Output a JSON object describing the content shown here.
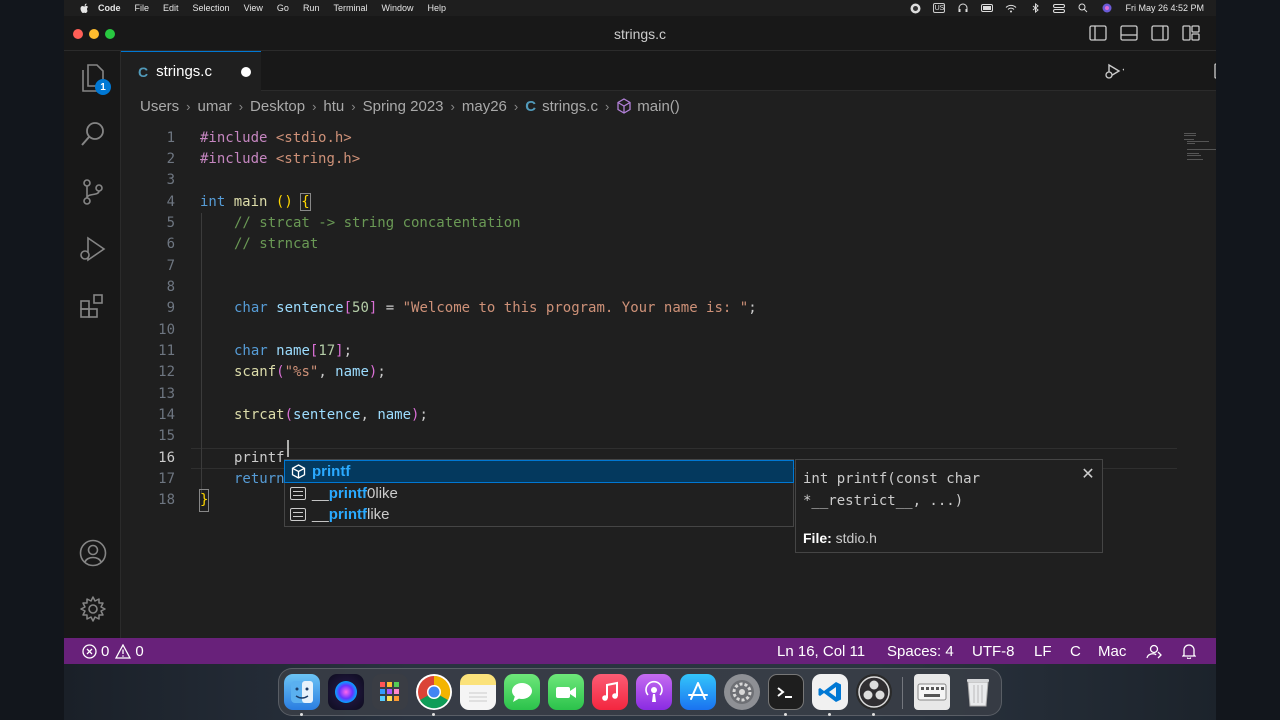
{
  "menubar": {
    "items": [
      "Code",
      "File",
      "Edit",
      "Selection",
      "View",
      "Go",
      "Run",
      "Terminal",
      "Window",
      "Help"
    ],
    "keyboard": "US",
    "clock": "Fri May 26  4:52 PM"
  },
  "window": {
    "title": "strings.c"
  },
  "activity": {
    "explorer_badge": "1"
  },
  "tab": {
    "icon": "C",
    "name": "strings.c"
  },
  "breadcrumb": {
    "parts": [
      "Users",
      "umar",
      "Desktop",
      "htu",
      "Spring 2023",
      "may26"
    ],
    "file_icon": "C",
    "file": "strings.c",
    "symbol": "main()"
  },
  "editor": {
    "line_numbers": [
      "1",
      "2",
      "3",
      "4",
      "5",
      "6",
      "7",
      "8",
      "9",
      "10",
      "11",
      "12",
      "13",
      "14",
      "15",
      "16",
      "17",
      "18"
    ],
    "active_line": "16",
    "l1_a": "#include",
    "l1_b": "<stdio.h>",
    "l2_a": "#include",
    "l2_b": "<string.h>",
    "l4_kw": "int",
    "l4_fn": "main",
    "l4_paren": "()",
    "l4_brace": "{",
    "l5": "// strcat -> string concatentation",
    "l6": "// strncat",
    "l9_kw": "char",
    "l9_var": "sentence",
    "l9_lb": "[",
    "l9_num": "50",
    "l9_rb": "]",
    "l9_eq": " = ",
    "l9_str": "\"Welcome to this program. Your name is: \"",
    "l9_end": ";",
    "l11_kw": "char",
    "l11_var": "name",
    "l11_lb": "[",
    "l11_num": "17",
    "l11_rb": "]",
    "l11_end": ";",
    "l12_fn": "scanf",
    "l12_lp": "(",
    "l12_str": "\"%s\"",
    "l12_comma": ", ",
    "l12_var": "name",
    "l12_rp": ")",
    "l12_end": ";",
    "l14_fn": "strcat",
    "l14_lp": "(",
    "l14_v1": "sentence",
    "l14_comma": ", ",
    "l14_v2": "name",
    "l14_rp": ")",
    "l14_end": ";",
    "l16": "printf",
    "l17": "return",
    "l18": "}"
  },
  "suggest": {
    "items": [
      {
        "match": "printf",
        "rest": "",
        "prefix": ""
      },
      {
        "prefix": "__",
        "match": "printf",
        "rest": "0like"
      },
      {
        "prefix": "__",
        "match": "printf",
        "rest": "like"
      }
    ]
  },
  "details": {
    "signature": "int printf(const char *__restrict__, ...)",
    "file_label": "File:",
    "file_value": "stdio.h",
    "close": "✕"
  },
  "statusbar": {
    "errors": "0",
    "warnings": "0",
    "position": "Ln 16, Col 11",
    "spaces": "Spaces: 4",
    "encoding": "UTF-8",
    "eol": "LF",
    "language": "C",
    "platform": "Mac"
  }
}
